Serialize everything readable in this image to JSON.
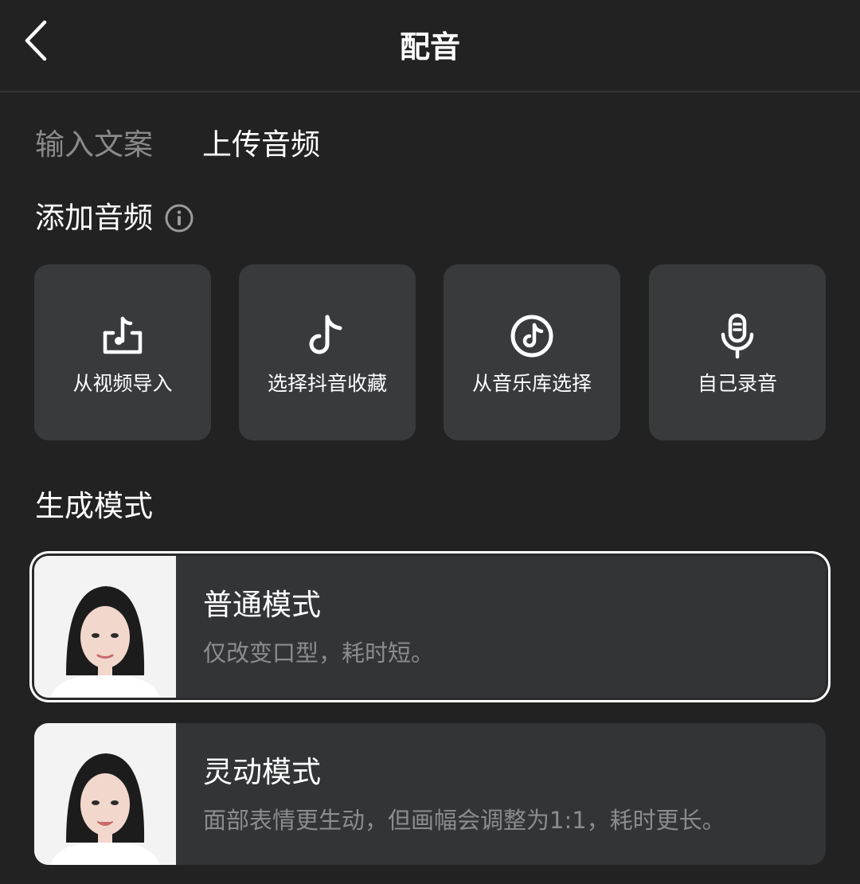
{
  "header": {
    "title": "配音",
    "back_icon": "chevron-left-icon"
  },
  "tabs": [
    {
      "label": "输入文案",
      "active": false
    },
    {
      "label": "上传音频",
      "active": true
    }
  ],
  "add_audio": {
    "title": "添加音频",
    "info_icon": "info-icon",
    "sources": [
      {
        "label": "从视频导入",
        "icon": "video-import-icon"
      },
      {
        "label": "选择抖音收藏",
        "icon": "douyin-note-icon"
      },
      {
        "label": "从音乐库选择",
        "icon": "music-disc-icon"
      },
      {
        "label": "自己录音",
        "icon": "microphone-icon"
      }
    ]
  },
  "generation": {
    "title": "生成模式",
    "modes": [
      {
        "title": "普通模式",
        "desc": "仅改变口型，耗时短。",
        "selected": true
      },
      {
        "title": "灵动模式",
        "desc": "面部表情更生动，但画幅会调整为1:1，耗时更长。",
        "selected": false
      }
    ]
  },
  "colors": {
    "background": "#222222",
    "card": "#383a3c",
    "text_primary": "#ffffff",
    "text_secondary": "#8c8c8c",
    "selected_border": "#ffffff"
  }
}
